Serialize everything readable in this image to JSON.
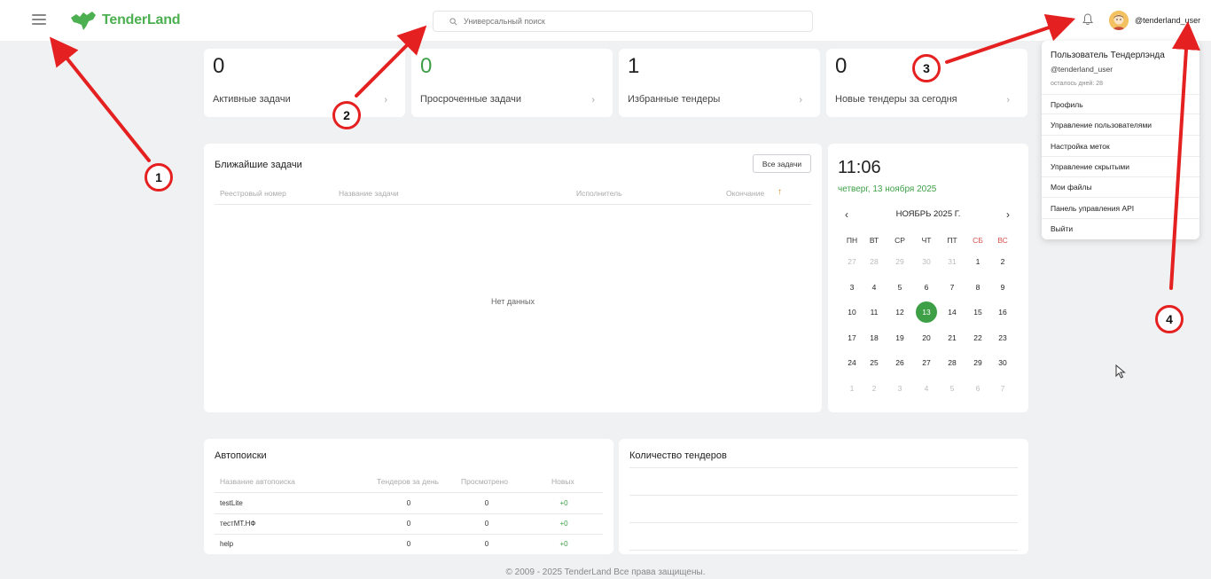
{
  "app": {
    "logo_text": "TenderLand"
  },
  "header": {
    "search_placeholder": "Универсальный поиск",
    "username": "@tenderland_user"
  },
  "stats": [
    {
      "value": "0",
      "label": "Активные задачи",
      "color": "#222222"
    },
    {
      "value": "0",
      "label": "Просроченные задачи",
      "color": "#3d9f46"
    },
    {
      "value": "1",
      "label": "Избранные тендеры",
      "color": "#222222"
    },
    {
      "value": "0",
      "label": "Новые тендеры за сегодня",
      "color": "#222222"
    }
  ],
  "tasks": {
    "title": "Ближайшие задачи",
    "all_button": "Все задачи",
    "columns": [
      "Реестровый номер",
      "Название задачи",
      "Исполнитель",
      "Окончание"
    ],
    "sort_arrow": "↑",
    "empty_text": "Нет данных"
  },
  "calendar": {
    "time": "11:06",
    "date": "четверг, 13 ноября 2025",
    "month": "НОЯБРЬ 2025 Г.",
    "prev": "‹",
    "next": "›",
    "weekdays": [
      "ПН",
      "ВТ",
      "СР",
      "ЧТ",
      "ПТ",
      "СБ",
      "ВС"
    ],
    "weeks": [
      [
        "27",
        "28",
        "29",
        "30",
        "31",
        "1",
        "2"
      ],
      [
        "3",
        "4",
        "5",
        "6",
        "7",
        "8",
        "9"
      ],
      [
        "10",
        "11",
        "12",
        "13",
        "14",
        "15",
        "16"
      ],
      [
        "17",
        "18",
        "19",
        "20",
        "21",
        "22",
        "23"
      ],
      [
        "24",
        "25",
        "26",
        "27",
        "28",
        "29",
        "30"
      ],
      [
        "1",
        "2",
        "3",
        "4",
        "5",
        "6",
        "7"
      ]
    ],
    "today": "13"
  },
  "dropdown": {
    "name": "Пользователь Тендерлэнда",
    "login": "@tenderland_user",
    "days_left": "осталось дней: 28",
    "items": [
      "Профиль",
      "Управление пользователями",
      "Настройка меток",
      "Управление скрытыми",
      "Мои файлы",
      "Панель управления API",
      "Выйти"
    ]
  },
  "autosearch": {
    "title": "Автопоиски",
    "columns": [
      "Название автопоиска",
      "Тендеров за день",
      "Просмотрено",
      "Новых"
    ],
    "rows": [
      {
        "name": "testLite",
        "per_day": "0",
        "viewed": "0",
        "new": "+0"
      },
      {
        "name": "тестMT.НФ",
        "per_day": "0",
        "viewed": "0",
        "new": "+0"
      },
      {
        "name": "help",
        "per_day": "0",
        "viewed": "0",
        "new": "+0"
      }
    ]
  },
  "tender_count": {
    "title": "Количество тендеров"
  },
  "footer": {
    "text": "© 2009 - 2025 TenderLand Все права защищены."
  },
  "annotations": [
    "1",
    "2",
    "3",
    "4"
  ],
  "colors": {
    "brand": "#4caf50",
    "accent": "#3d9f46",
    "annotation": "#e52020",
    "weekend": "#d9534f"
  }
}
